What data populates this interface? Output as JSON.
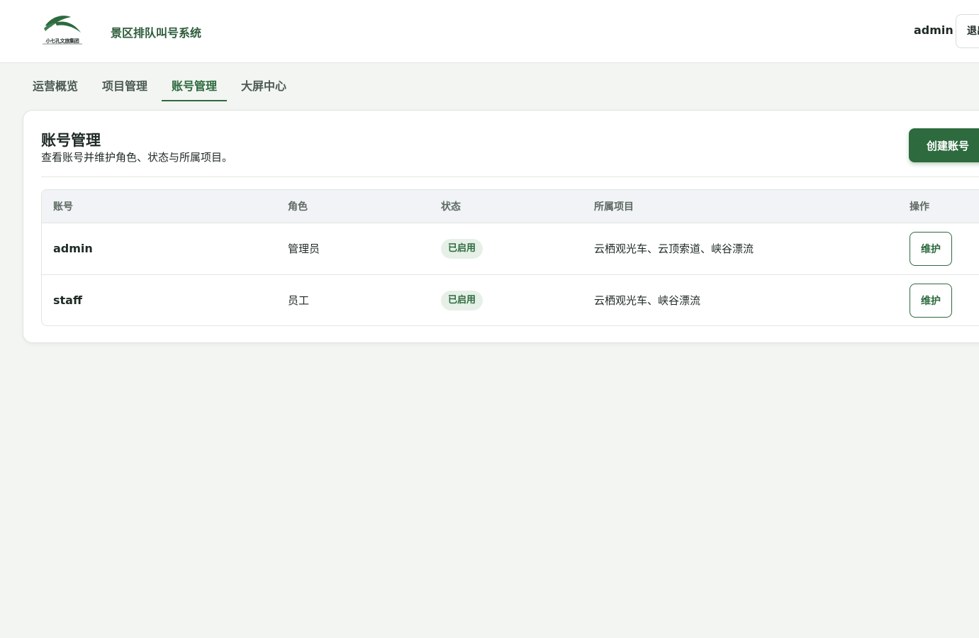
{
  "header": {
    "logo_text": "小七孔文旅集团",
    "app_title": "景区排队叫号系统",
    "user": "admin",
    "logout_label": "退出"
  },
  "tabs": [
    {
      "label": "运营概览",
      "active": false
    },
    {
      "label": "项目管理",
      "active": false
    },
    {
      "label": "账号管理",
      "active": true
    },
    {
      "label": "大屏中心",
      "active": false
    }
  ],
  "card": {
    "title": "账号管理",
    "subtitle": "查看账号并维护角色、状态与所属项目。",
    "create_label": "创建账号"
  },
  "table": {
    "columns": [
      "账号",
      "角色",
      "状态",
      "所属项目",
      "操作"
    ],
    "rows": [
      {
        "account": "admin",
        "role": "管理员",
        "status": "已启用",
        "projects": "云栖观光车、云顶索道、峡谷漂流",
        "action": "维护"
      },
      {
        "account": "staff",
        "role": "员工",
        "status": "已启用",
        "projects": "云栖观光车、峡谷漂流",
        "action": "维护"
      }
    ]
  },
  "colors": {
    "accent": "#2d6a3e",
    "background": "#f3f5f2",
    "badge_bg": "#e6f0e7"
  }
}
